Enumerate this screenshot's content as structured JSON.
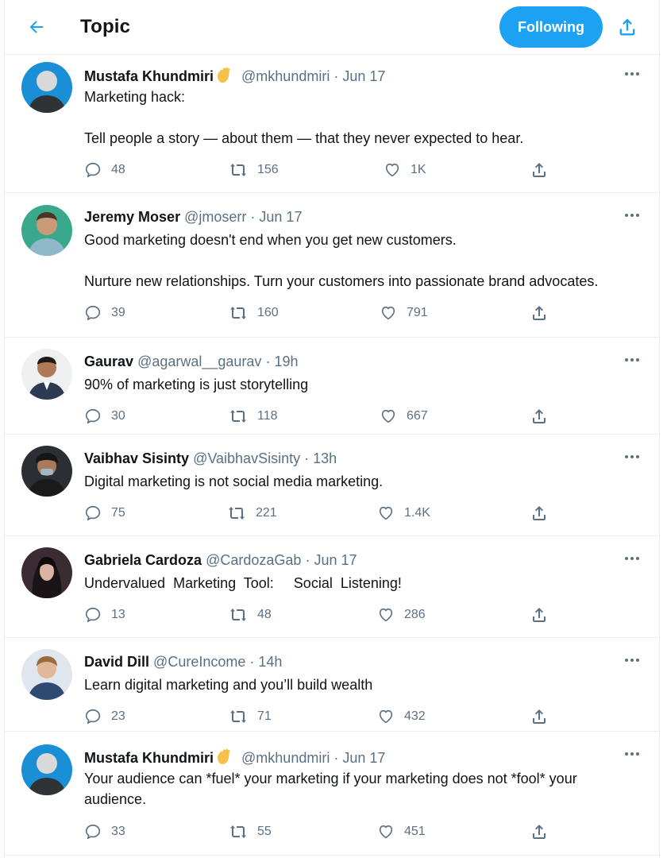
{
  "header": {
    "title": "Topic",
    "follow_label": "Following"
  },
  "colors": {
    "accent": "#1da1f2",
    "text_primary": "#0f1419",
    "text_secondary": "#5b7083",
    "border": "#ebeef0"
  },
  "icons": {
    "back": "arrow-left-icon",
    "share_topic": "share-icon",
    "more": "more-dots-icon",
    "reply": "reply-icon",
    "retweet": "retweet-icon",
    "like": "heart-icon",
    "share": "share-icon",
    "verified_emoji": "waving-hand-emoji"
  },
  "tweets": [
    {
      "name": "Mustafa Khundmiri",
      "handle": "@mkhundmiri",
      "sep": "·",
      "time": "Jun 17",
      "text": "Marketing hack:\n\nTell people a story — about them — that they never expected to hear.",
      "replies": "48",
      "retweets": "156",
      "likes": "1K"
    },
    {
      "name": "Jeremy Moser",
      "handle": "@jmoserr",
      "sep": "·",
      "time": "Jun 17",
      "text": "Good marketing doesn't end when you get new customers.\n\nNurture new relationships. Turn your customers into passionate brand advocates.",
      "replies": "39",
      "retweets": "160",
      "likes": "791"
    },
    {
      "name": "Gaurav",
      "handle": "@agarwal__gaurav",
      "sep": "·",
      "time": "19h",
      "text": "90% of marketing is just storytelling",
      "replies": "30",
      "retweets": "118",
      "likes": "667"
    },
    {
      "name": "Vaibhav Sisinty",
      "handle": "@VaibhavSisinty",
      "sep": "·",
      "time": "13h",
      "text": "Digital marketing is not social media marketing.",
      "replies": "75",
      "retweets": "221",
      "likes": "1.4K"
    },
    {
      "name": "Gabriela Cardoza",
      "handle": "@CardozaGab",
      "sep": "·",
      "time": "Jun 17",
      "text": "Undervalued  Marketing  Tool:     Social  Listening!",
      "replies": "13",
      "retweets": "48",
      "likes": "286"
    },
    {
      "name": "David Dill",
      "handle": "@CureIncome",
      "sep": "·",
      "time": "14h",
      "text": "Learn digital marketing and you’ll build wealth",
      "replies": "23",
      "retweets": "71",
      "likes": "432"
    },
    {
      "name": "Mustafa Khundmiri",
      "handle": "@mkhundmiri",
      "sep": "·",
      "time": "Jun 17",
      "text": "Your audience can *fuel* your marketing if your marketing does not *fool* your audience.",
      "replies": "33",
      "retweets": "55",
      "likes": "451"
    }
  ]
}
